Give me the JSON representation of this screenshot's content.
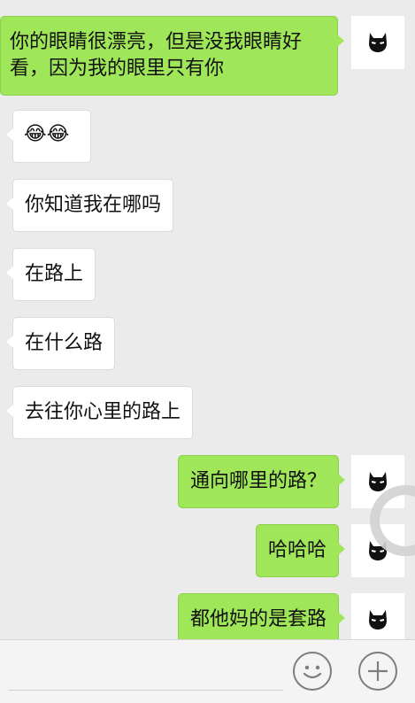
{
  "messages": [
    {
      "side": "right",
      "text": "你的眼睛很漂亮，但是没我眼睛好看，因为我的眼里只有你",
      "avatar": "batman-mask-icon"
    },
    {
      "side": "left",
      "text": "😂😂"
    },
    {
      "side": "left",
      "text": "你知道我在哪吗"
    },
    {
      "side": "left",
      "text": "在路上"
    },
    {
      "side": "left",
      "text": "在什么路"
    },
    {
      "side": "left",
      "text": "去往你心里的路上"
    },
    {
      "side": "right",
      "text": "通向哪里的路？",
      "avatar": "batman-mask-icon"
    },
    {
      "side": "right",
      "text": "哈哈哈",
      "avatar": "batman-mask-icon"
    },
    {
      "side": "right",
      "text": "都他妈的是套路",
      "avatar": "batman-mask-icon"
    }
  ],
  "input_bar": {
    "emoji_icon": "smiley-face-icon",
    "plus_icon": "plus-icon"
  },
  "colors": {
    "background": "#ebebeb",
    "sent_bubble": "#9fe658",
    "received_bubble": "#ffffff"
  }
}
